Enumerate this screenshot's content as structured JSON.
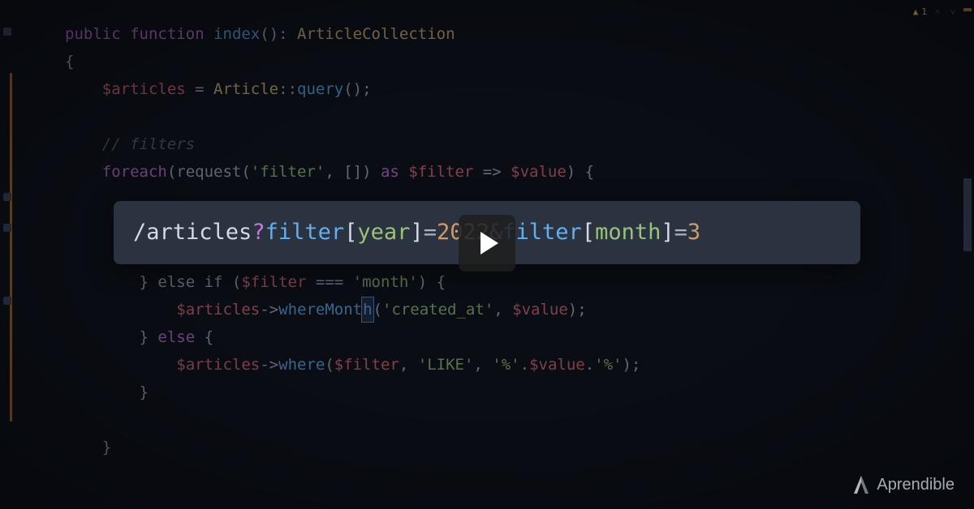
{
  "warning": {
    "count": "1"
  },
  "code": {
    "l1_public": "public",
    "l1_function": "function",
    "l1_name": "index",
    "l1_parens": "():",
    "l1_type": "ArticleCollection",
    "l2_brace": "{",
    "l3_var": "$articles",
    "l3_eq": " = ",
    "l3_class": "Article",
    "l3_scope": "::",
    "l3_method": "query",
    "l3_end": "();",
    "l5_comment": "// filters",
    "l6_foreach": "foreach",
    "l6_req": "(request(",
    "l6_s1": "'filter'",
    "l6_c1": ", [])",
    "l6_as": " as ",
    "l6_v1": "$filter",
    "l6_arrow": " => ",
    "l6_v2": "$value",
    "l6_end": ") {",
    "l8_else": "} else if (",
    "l8_var": "$filter",
    "l8_eqeq": " === ",
    "l8_str": "'month'",
    "l8_end": ") {",
    "l9_var": "$articles",
    "l9_arrow": "->",
    "l9_method_a": "whereMont",
    "l9_method_h": "h",
    "l9_open": "(",
    "l9_s1": "'created_at'",
    "l9_c": ", ",
    "l9_v": "$value",
    "l9_end": ");",
    "l10_else": "} else {",
    "l11_var": "$articles",
    "l11_arrow": "->",
    "l11_method": "where",
    "l11_open": "(",
    "l11_v1": "$filter",
    "l11_c1": ", ",
    "l11_s1": "'LIKE'",
    "l11_c2": ", ",
    "l11_s2": "'%'",
    "l11_dot1": ".",
    "l11_v2": "$value",
    "l11_dot2": ".",
    "l11_s3": "'%'",
    "l11_end": ");",
    "l12_brace": "}",
    "l13_brace": "}"
  },
  "overlay": {
    "path": "/articles",
    "q": "?",
    "k1": "filter",
    "br_open1": "[",
    "f1": "year",
    "br_close1": "]",
    "eq1": "=",
    "v1": "2022",
    "amp": "&",
    "k2": "filter",
    "br_open2": "[",
    "f2": "month",
    "br_close2": "]",
    "eq2": "=",
    "v2": "3"
  },
  "brand": "Aprendible"
}
